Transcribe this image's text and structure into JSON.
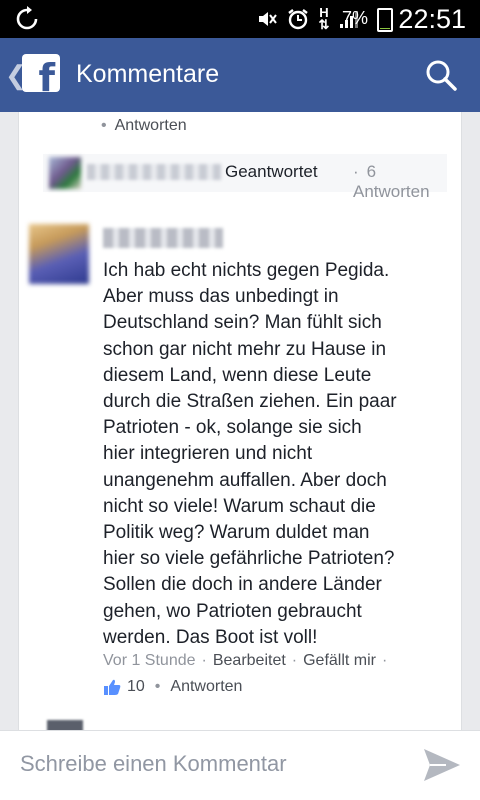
{
  "status_bar": {
    "battery_percent": "7%",
    "battery_level": 0.07,
    "network_label": "H",
    "time": "22:51",
    "icons": [
      "sync-icon",
      "mute-icon",
      "alarm-icon",
      "network-h-icon",
      "signal-icon",
      "battery-icon"
    ]
  },
  "header": {
    "title": "Kommentare",
    "logo_letter": "f",
    "back_icon": "chevron-left-icon",
    "search_icon": "search-icon",
    "color": "#3b5998"
  },
  "previous_comment": {
    "reply_link": "Antworten"
  },
  "reply_summary": {
    "status": "Geantwortet",
    "count_label": "6 Antworten"
  },
  "comment": {
    "lines": [
      "Ich hab echt nichts gegen Pegida.",
      "Aber muss das unbedingt in",
      "Deutschland sein? Man fühlt sich",
      "schon gar nicht mehr zu Hause in",
      "diesem Land, wenn diese Leute",
      "durch die Straßen ziehen. Ein paar",
      "Patrioten - ok, solange sie sich",
      "hier integrieren und nicht",
      "unangenehm auffallen. Aber doch",
      "nicht so viele! Warum schaut die",
      "Politik weg? Warum duldet man",
      "hier so viele gefährliche Patrioten?",
      "Sollen die doch in andere Länder",
      "gehen, wo Patrioten gebraucht",
      "werden. Das Boot ist voll!"
    ],
    "time": "Vor 1 Stunde",
    "edited": "Bearbeitet",
    "like_link": "Gefällt mir",
    "like_count": "10",
    "reply_link": "Antworten"
  },
  "composer": {
    "placeholder": "Schreibe einen Kommentar",
    "send_icon": "send-icon"
  }
}
